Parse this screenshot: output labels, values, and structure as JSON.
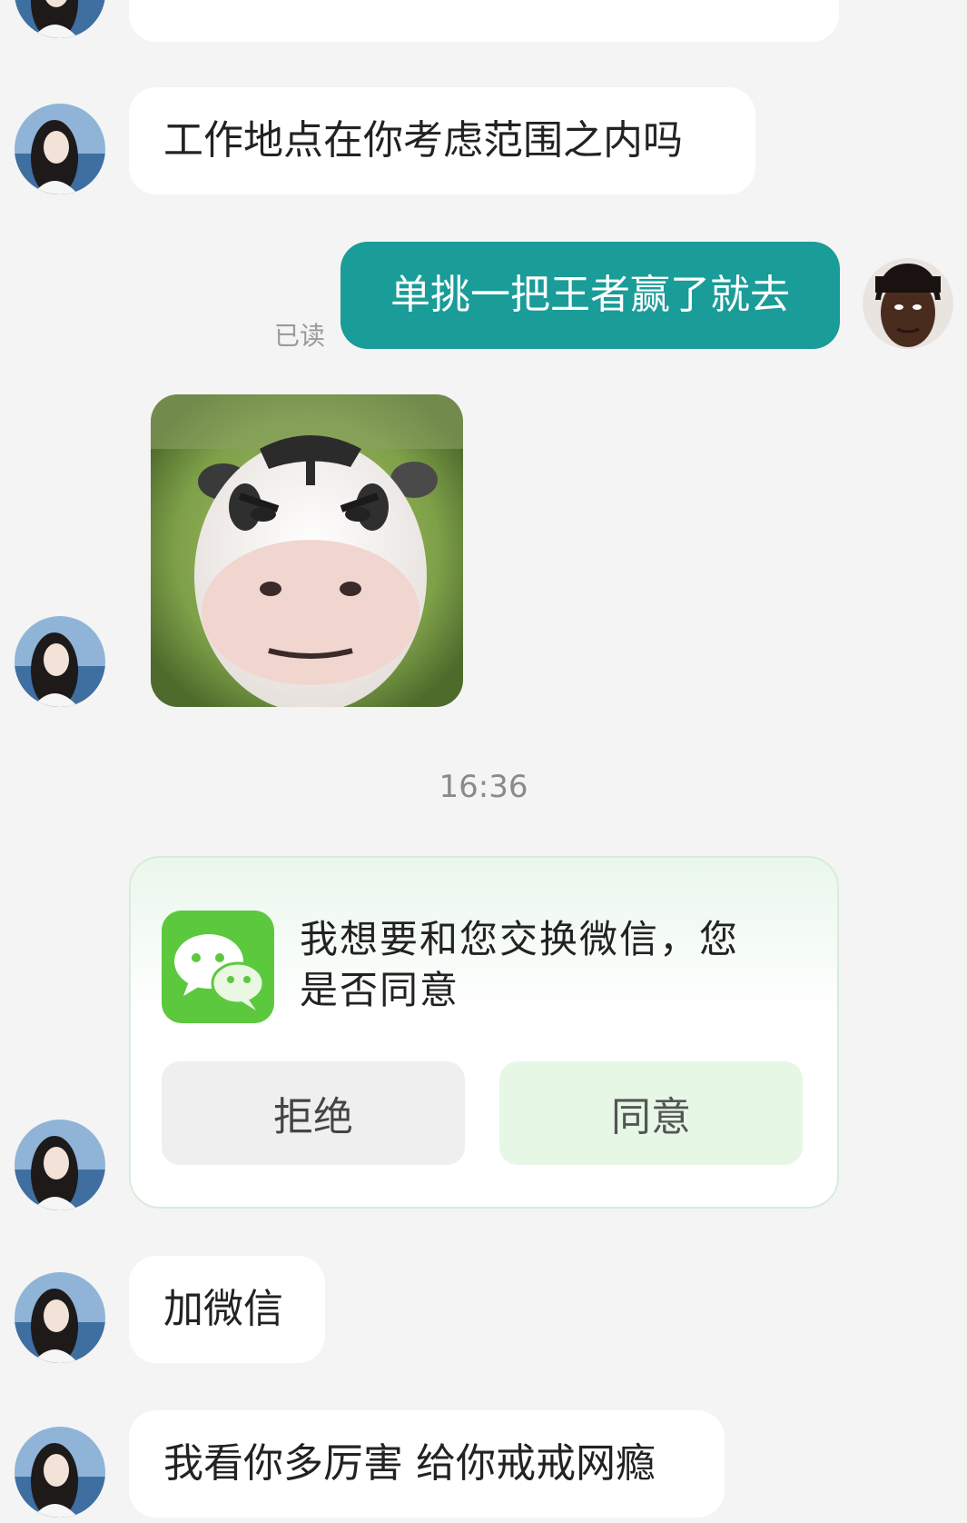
{
  "messages": {
    "msg1": {
      "text": "工作地点在你考虑范围之内吗"
    },
    "msg2": {
      "text": "单挑一把王者赢了就去",
      "status": "已读"
    },
    "msg4": {
      "text": "加微信"
    },
    "msg5": {
      "text": "我看你多厉害 给你戒戒网瘾"
    }
  },
  "timestamp": "16:36",
  "exchange_card": {
    "text": "我想要和您交换微信，您是否同意",
    "reject_label": "拒绝",
    "accept_label": "同意"
  },
  "colors": {
    "background": "#f4f4f4",
    "outgoing_bubble": "#1a9c98",
    "wechat_green": "#5cc83e"
  }
}
